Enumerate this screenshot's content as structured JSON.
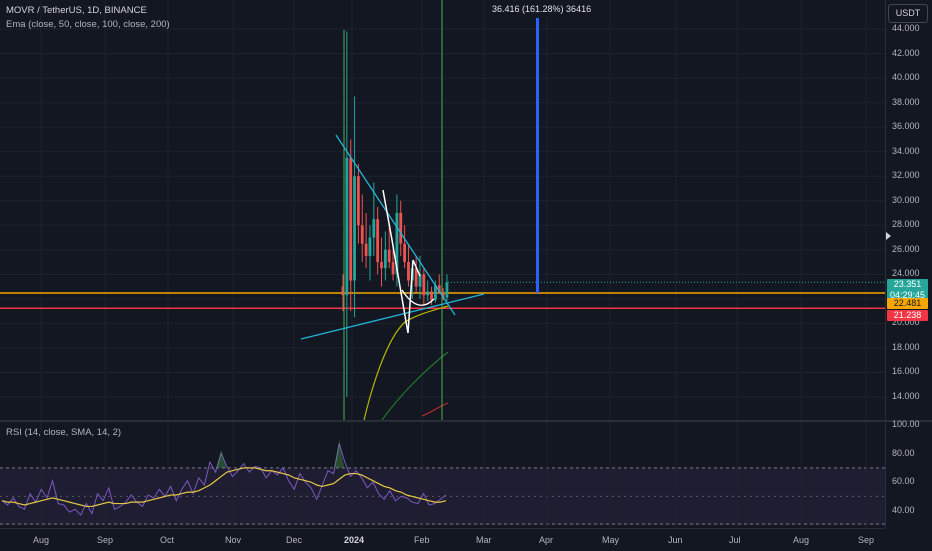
{
  "legend": {
    "symbol": "MOVR / TetherUS, 1D, BINANCE",
    "ema": "Ema (close, 50, close, 100, close, 200)",
    "rsi": "RSI (14, close, SMA, 14, 2)"
  },
  "currency_label": "USDT",
  "measure_label": "36.416 (161.28%) 36416",
  "price_axis": [
    "44.000",
    "42.000",
    "40.000",
    "38.000",
    "36.000",
    "34.000",
    "32.000",
    "30.000",
    "28.000",
    "26.000",
    "24.000",
    "22.000",
    "20.000",
    "18.000",
    "16.000",
    "14.000"
  ],
  "rsi_axis": [
    "100.00",
    "80.00",
    "60.00",
    "40.00"
  ],
  "time_axis": [
    "Aug",
    "Sep",
    "Oct",
    "Nov",
    "Dec",
    "2024",
    "Feb",
    "Mar",
    "Apr",
    "May",
    "Jun",
    "Jul",
    "Aug",
    "Sep"
  ],
  "badges": {
    "last_price": "23.351",
    "countdown": "04:29:45",
    "orange_level": "22.481",
    "red_level": "21.238"
  },
  "colors": {
    "background": "#131722",
    "up": "#26a69a",
    "down": "#ef5350",
    "orange_line": "#f7a600",
    "red_line": "#f23645",
    "trendline": "#22b5d8",
    "rsi": "#7e57c2",
    "rsi_ma": "#e6c845",
    "measure_bar": "#2962ff"
  },
  "chart_data": [
    {
      "type": "candlestick",
      "title": "MOVR / TetherUS, 1D, BINANCE",
      "ylim": [
        12.6,
        45.2
      ],
      "y_ticks": [
        14,
        16,
        18,
        20,
        22,
        24,
        26,
        28,
        30,
        32,
        34,
        36,
        38,
        40,
        42,
        44
      ],
      "x_ticks": [
        "Aug",
        "Sep",
        "Oct",
        "Nov",
        "Dec",
        "2024",
        "Feb",
        "Mar",
        "Apr",
        "May",
        "Jun",
        "Jul",
        "Aug",
        "Sep"
      ],
      "candles_approx": [
        [
          23.0,
          24.0,
          21.0,
          22.3
        ],
        [
          22.3,
          43.8,
          14.0,
          33.5
        ],
        [
          33.5,
          35.0,
          21.0,
          23.5
        ],
        [
          23.5,
          38.5,
          20.5,
          32.0
        ],
        [
          32.0,
          33.0,
          26.5,
          28.0
        ],
        [
          28.0,
          30.5,
          25.0,
          26.5
        ],
        [
          26.5,
          29.0,
          24.5,
          25.5
        ],
        [
          25.5,
          28.0,
          23.5,
          27.0
        ],
        [
          27.0,
          31.5,
          25.5,
          28.5
        ],
        [
          28.5,
          29.5,
          24.0,
          25.0
        ],
        [
          25.0,
          27.0,
          23.0,
          24.5
        ],
        [
          24.5,
          27.5,
          23.5,
          26.0
        ],
        [
          26.0,
          28.0,
          24.5,
          25.0
        ],
        [
          25.0,
          26.5,
          23.5,
          24.0
        ],
        [
          24.0,
          30.5,
          23.0,
          29.0
        ],
        [
          29.0,
          30.0,
          25.5,
          26.5
        ],
        [
          26.5,
          28.0,
          24.5,
          25.0
        ],
        [
          25.0,
          26.5,
          23.0,
          23.5
        ],
        [
          23.5,
          25.0,
          22.0,
          24.5
        ],
        [
          24.5,
          25.5,
          22.5,
          23.0
        ],
        [
          23.0,
          25.5,
          22.0,
          24.0
        ],
        [
          24.0,
          24.5,
          21.5,
          22.3
        ],
        [
          22.3,
          23.5,
          21.8,
          22.6
        ],
        [
          22.6,
          23.0,
          21.5,
          21.9
        ],
        [
          21.9,
          23.5,
          21.7,
          23.1
        ],
        [
          23.1,
          24.0,
          22.5,
          22.4
        ],
        [
          22.4,
          22.9,
          21.9,
          22.1
        ],
        [
          22.1,
          24.0,
          21.8,
          23.35
        ]
      ],
      "ema": {
        "ema50_start": 13.0,
        "ema50_end": 22.0,
        "ema100": [
          14.0,
          17.8
        ],
        "ema200": [
          12.7,
          14.0
        ]
      },
      "levels": {
        "orange": 22.481,
        "red": 21.238
      },
      "measure": {
        "change": 36.416,
        "percent": 161.28,
        "from": 22.0,
        "to": 58.4
      }
    },
    {
      "type": "line",
      "title": "RSI (14, close, SMA, 14, 2)",
      "ylim": [
        30,
        100
      ],
      "y_ticks": [
        100,
        80,
        60,
        40
      ],
      "bands": [
        70,
        30
      ],
      "midline": 50,
      "series": [
        {
          "name": "RSI",
          "values": [
            47,
            44,
            49,
            43,
            41,
            52,
            46,
            55,
            49,
            61,
            45,
            44,
            39,
            41,
            37,
            45,
            38,
            52,
            47,
            56,
            41,
            43,
            46,
            51,
            46,
            43,
            51,
            49,
            55,
            50,
            57,
            47,
            55,
            61,
            52,
            63,
            58,
            74,
            67,
            80,
            71,
            64,
            68,
            73,
            67,
            71,
            70,
            63,
            68,
            65,
            70,
            61,
            55,
            66,
            60,
            56,
            48,
            58,
            68,
            66,
            87,
            74,
            64,
            68,
            63,
            56,
            60,
            52,
            48,
            54,
            47,
            50,
            49,
            46,
            45,
            52,
            44,
            45,
            48,
            51
          ]
        },
        {
          "name": "RSI-based MA",
          "values": [
            47,
            46,
            46,
            45,
            44,
            45,
            46,
            47,
            48,
            49,
            48,
            47,
            46,
            45,
            44,
            43,
            43,
            44,
            45,
            46,
            45,
            45,
            45,
            46,
            46,
            46,
            47,
            48,
            49,
            50,
            51,
            51,
            52,
            53,
            53,
            54,
            56,
            58,
            61,
            64,
            67,
            68,
            69,
            70,
            70,
            70,
            69,
            68,
            68,
            67,
            66,
            65,
            63,
            62,
            61,
            60,
            58,
            57,
            58,
            59,
            62,
            65,
            66,
            66,
            65,
            63,
            61,
            59,
            57,
            56,
            54,
            53,
            51,
            50,
            49,
            48,
            47,
            46,
            46,
            47
          ]
        }
      ]
    }
  ]
}
